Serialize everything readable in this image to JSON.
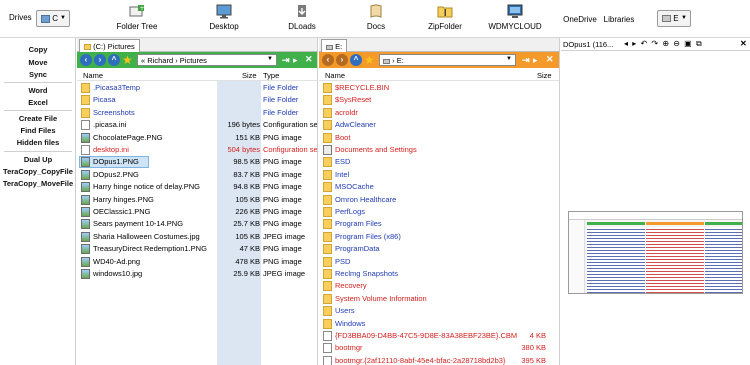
{
  "toolbar": {
    "drives_label": "Drives",
    "left_drive": "C",
    "right_drive": "E",
    "buttons": [
      {
        "label": "Folder Tree",
        "icon": "folder-tree-icon"
      },
      {
        "label": "Desktop",
        "icon": "desktop-icon"
      },
      {
        "label": "DLoads",
        "icon": "downloads-icon"
      },
      {
        "label": "Docs",
        "icon": "documents-icon"
      },
      {
        "label": "ZipFolder",
        "icon": "zip-folder-icon"
      },
      {
        "label": "WDMYCLOUD",
        "icon": "network-drive-icon"
      },
      {
        "label": "OneDrive",
        "icon": ""
      },
      {
        "label": "Libraries",
        "icon": ""
      }
    ]
  },
  "left_buttons": [
    "Copy",
    "Move",
    "Sync",
    "Word",
    "Excel",
    "Create File",
    "Find Files",
    "Hidden files",
    "Dual Up",
    "TeraCopy_CopyFile",
    "TeraCopy_MoveFile"
  ],
  "left_pane": {
    "tab": "(C:) Pictures",
    "path": [
      "Richard",
      "Pictures"
    ],
    "columns": {
      "name": "Name",
      "size": "Size",
      "type": "Type"
    },
    "rows": [
      {
        "name": ".Picasa3Temp",
        "size": "",
        "type": "File Folder",
        "kind": "folder",
        "color": "#1f3bb3"
      },
      {
        "name": "Picasa",
        "size": "",
        "type": "File Folder",
        "kind": "folder",
        "color": "#1f3bb3"
      },
      {
        "name": "Screenshots",
        "size": "",
        "type": "File Folder",
        "kind": "folder",
        "color": "#1f3bb3"
      },
      {
        "name": ".picasa.ini",
        "size": "196 bytes",
        "type": "Configuration se",
        "kind": "file",
        "color": "#000000"
      },
      {
        "name": "ChocolatePage.PNG",
        "size": "151 KB",
        "type": "PNG image",
        "kind": "img",
        "color": "#000000"
      },
      {
        "name": "desktop.ini",
        "size": "504 bytes",
        "type": "Configuration se",
        "kind": "file",
        "color": "#d42020"
      },
      {
        "name": "DOpus1.PNG",
        "size": "98.5 KB",
        "type": "PNG image",
        "kind": "img",
        "color": "#000000"
      },
      {
        "name": "DOpus2.PNG",
        "size": "83.7 KB",
        "type": "PNG image",
        "kind": "img",
        "color": "#000000"
      },
      {
        "name": "Harry hinge notice of delay.PNG",
        "size": "94.8 KB",
        "type": "PNG image",
        "kind": "img",
        "color": "#000000"
      },
      {
        "name": "Harry hinges.PNG",
        "size": "105 KB",
        "type": "PNG image",
        "kind": "img",
        "color": "#000000"
      },
      {
        "name": "OEClassic1.PNG",
        "size": "226 KB",
        "type": "PNG image",
        "kind": "img",
        "color": "#000000"
      },
      {
        "name": "Sears payment 10-14.PNG",
        "size": "25.7 KB",
        "type": "PNG image",
        "kind": "img",
        "color": "#000000"
      },
      {
        "name": "Sharia Halloween Costumes.jpg",
        "size": "105 KB",
        "type": "JPEG image",
        "kind": "img",
        "color": "#000000"
      },
      {
        "name": "TreasuryDirect Redemption1.PNG",
        "size": "47 KB",
        "type": "PNG image",
        "kind": "img",
        "color": "#000000"
      },
      {
        "name": "WD40-Ad.png",
        "size": "478 KB",
        "type": "PNG image",
        "kind": "img",
        "color": "#000000"
      },
      {
        "name": "windows10.jpg",
        "size": "25.9 KB",
        "type": "JPEG image",
        "kind": "img",
        "color": "#000000"
      }
    ],
    "selected_row": 6
  },
  "right_pane": {
    "tab": "E:",
    "path": [
      "E:"
    ],
    "columns": {
      "name": "Name",
      "size": "Size"
    },
    "rows": [
      {
        "name": "$RECYCLE.BIN",
        "size": "",
        "kind": "folder",
        "color": "#d42020"
      },
      {
        "name": "$SysReset",
        "size": "",
        "kind": "folder",
        "color": "#d42020"
      },
      {
        "name": "acroldr",
        "size": "",
        "kind": "folder",
        "color": "#d42020"
      },
      {
        "name": "AdwCleaner",
        "size": "",
        "kind": "folder",
        "color": "#1f3bb3"
      },
      {
        "name": "Boot",
        "size": "",
        "kind": "folder",
        "color": "#d42020"
      },
      {
        "name": "Documents and Settings",
        "size": "",
        "kind": "sys",
        "color": "#d42020"
      },
      {
        "name": "ESD",
        "size": "",
        "kind": "folder",
        "color": "#1f3bb3"
      },
      {
        "name": "Intel",
        "size": "",
        "kind": "folder",
        "color": "#1f3bb3"
      },
      {
        "name": "MSOCache",
        "size": "",
        "kind": "folder",
        "color": "#1f3bb3"
      },
      {
        "name": "Omron Healthcare",
        "size": "",
        "kind": "folder",
        "color": "#1f3bb3"
      },
      {
        "name": "PerfLogs",
        "size": "",
        "kind": "folder",
        "color": "#1f3bb3"
      },
      {
        "name": "Program Files",
        "size": "",
        "kind": "folder",
        "color": "#1f3bb3"
      },
      {
        "name": "Program Files (x86)",
        "size": "",
        "kind": "folder",
        "color": "#1f3bb3"
      },
      {
        "name": "ProgramData",
        "size": "",
        "kind": "folder",
        "color": "#1f3bb3"
      },
      {
        "name": "PSD",
        "size": "",
        "kind": "folder",
        "color": "#1f3bb3"
      },
      {
        "name": "Reclmg Snapshots",
        "size": "",
        "kind": "folder",
        "color": "#1f3bb3"
      },
      {
        "name": "Recovery",
        "size": "",
        "kind": "folder",
        "color": "#d42020"
      },
      {
        "name": "System Volume Information",
        "size": "",
        "kind": "folder",
        "color": "#d42020"
      },
      {
        "name": "Users",
        "size": "",
        "kind": "folder",
        "color": "#1f3bb3"
      },
      {
        "name": "Windows",
        "size": "",
        "kind": "folder",
        "color": "#1f3bb3"
      },
      {
        "name": "{FD3BBA09-D4BB-47C5-9D8E-83A38EBF23BE}.CBM",
        "size": "4 KB",
        "kind": "file",
        "color": "#d42020"
      },
      {
        "name": "bootmgr",
        "size": "380 KB",
        "kind": "file",
        "color": "#d42020"
      },
      {
        "name": "bootmgr.{2af12110-8abf-45e4-bfac-2a28718bd2b3}",
        "size": "395 KB",
        "kind": "file",
        "color": "#d42020"
      }
    ]
  },
  "viewer": {
    "title": "DOpus1 (116..."
  },
  "colors": {
    "left_locbar": "#3fb04a",
    "right_locbar": "#f39a2a",
    "size_column_band": "#dce6f3",
    "selection": "#cde4f7"
  }
}
